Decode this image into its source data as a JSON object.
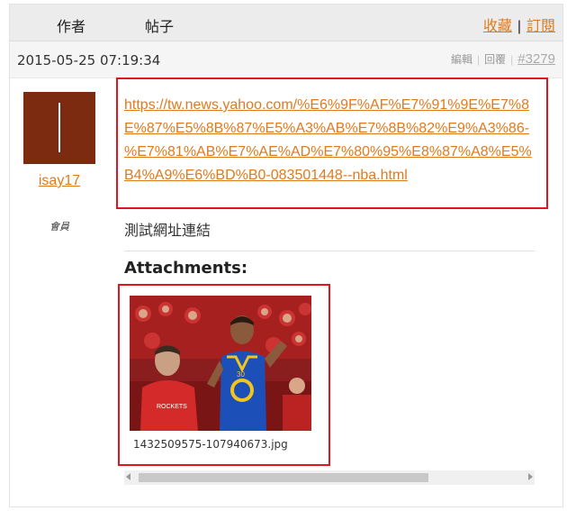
{
  "header": {
    "author_label": "作者",
    "post_label": "帖子",
    "favorite_label": "收藏",
    "separator": "|",
    "subscribe_label": "訂閱"
  },
  "post": {
    "date": "2015-05-25 07:19:34",
    "edit_label": "編輯",
    "reply_label": "回覆",
    "post_number": "#3279",
    "url": "https://tw.news.yahoo.com/%E6%9F%AF%E7%91%9E%E7%8E%87%E5%8B%87%E5%A3%AB%E7%8B%82%E9%A3%86-%E7%81%AB%E7%AE%AD%E7%80%95%E8%87%A8%E5%B4%A9%E6%BD%B0-083501448--nba.html",
    "body_text": "測試網址連結"
  },
  "user": {
    "username": "isay17",
    "role": "會員"
  },
  "attachments": {
    "title": "Attachments:",
    "file_name": "1432509575-107940673.jpg"
  },
  "colors": {
    "link": "#e07a1f",
    "highlight_box": "#e0161c",
    "avatar_bg": "#7c2a10"
  }
}
